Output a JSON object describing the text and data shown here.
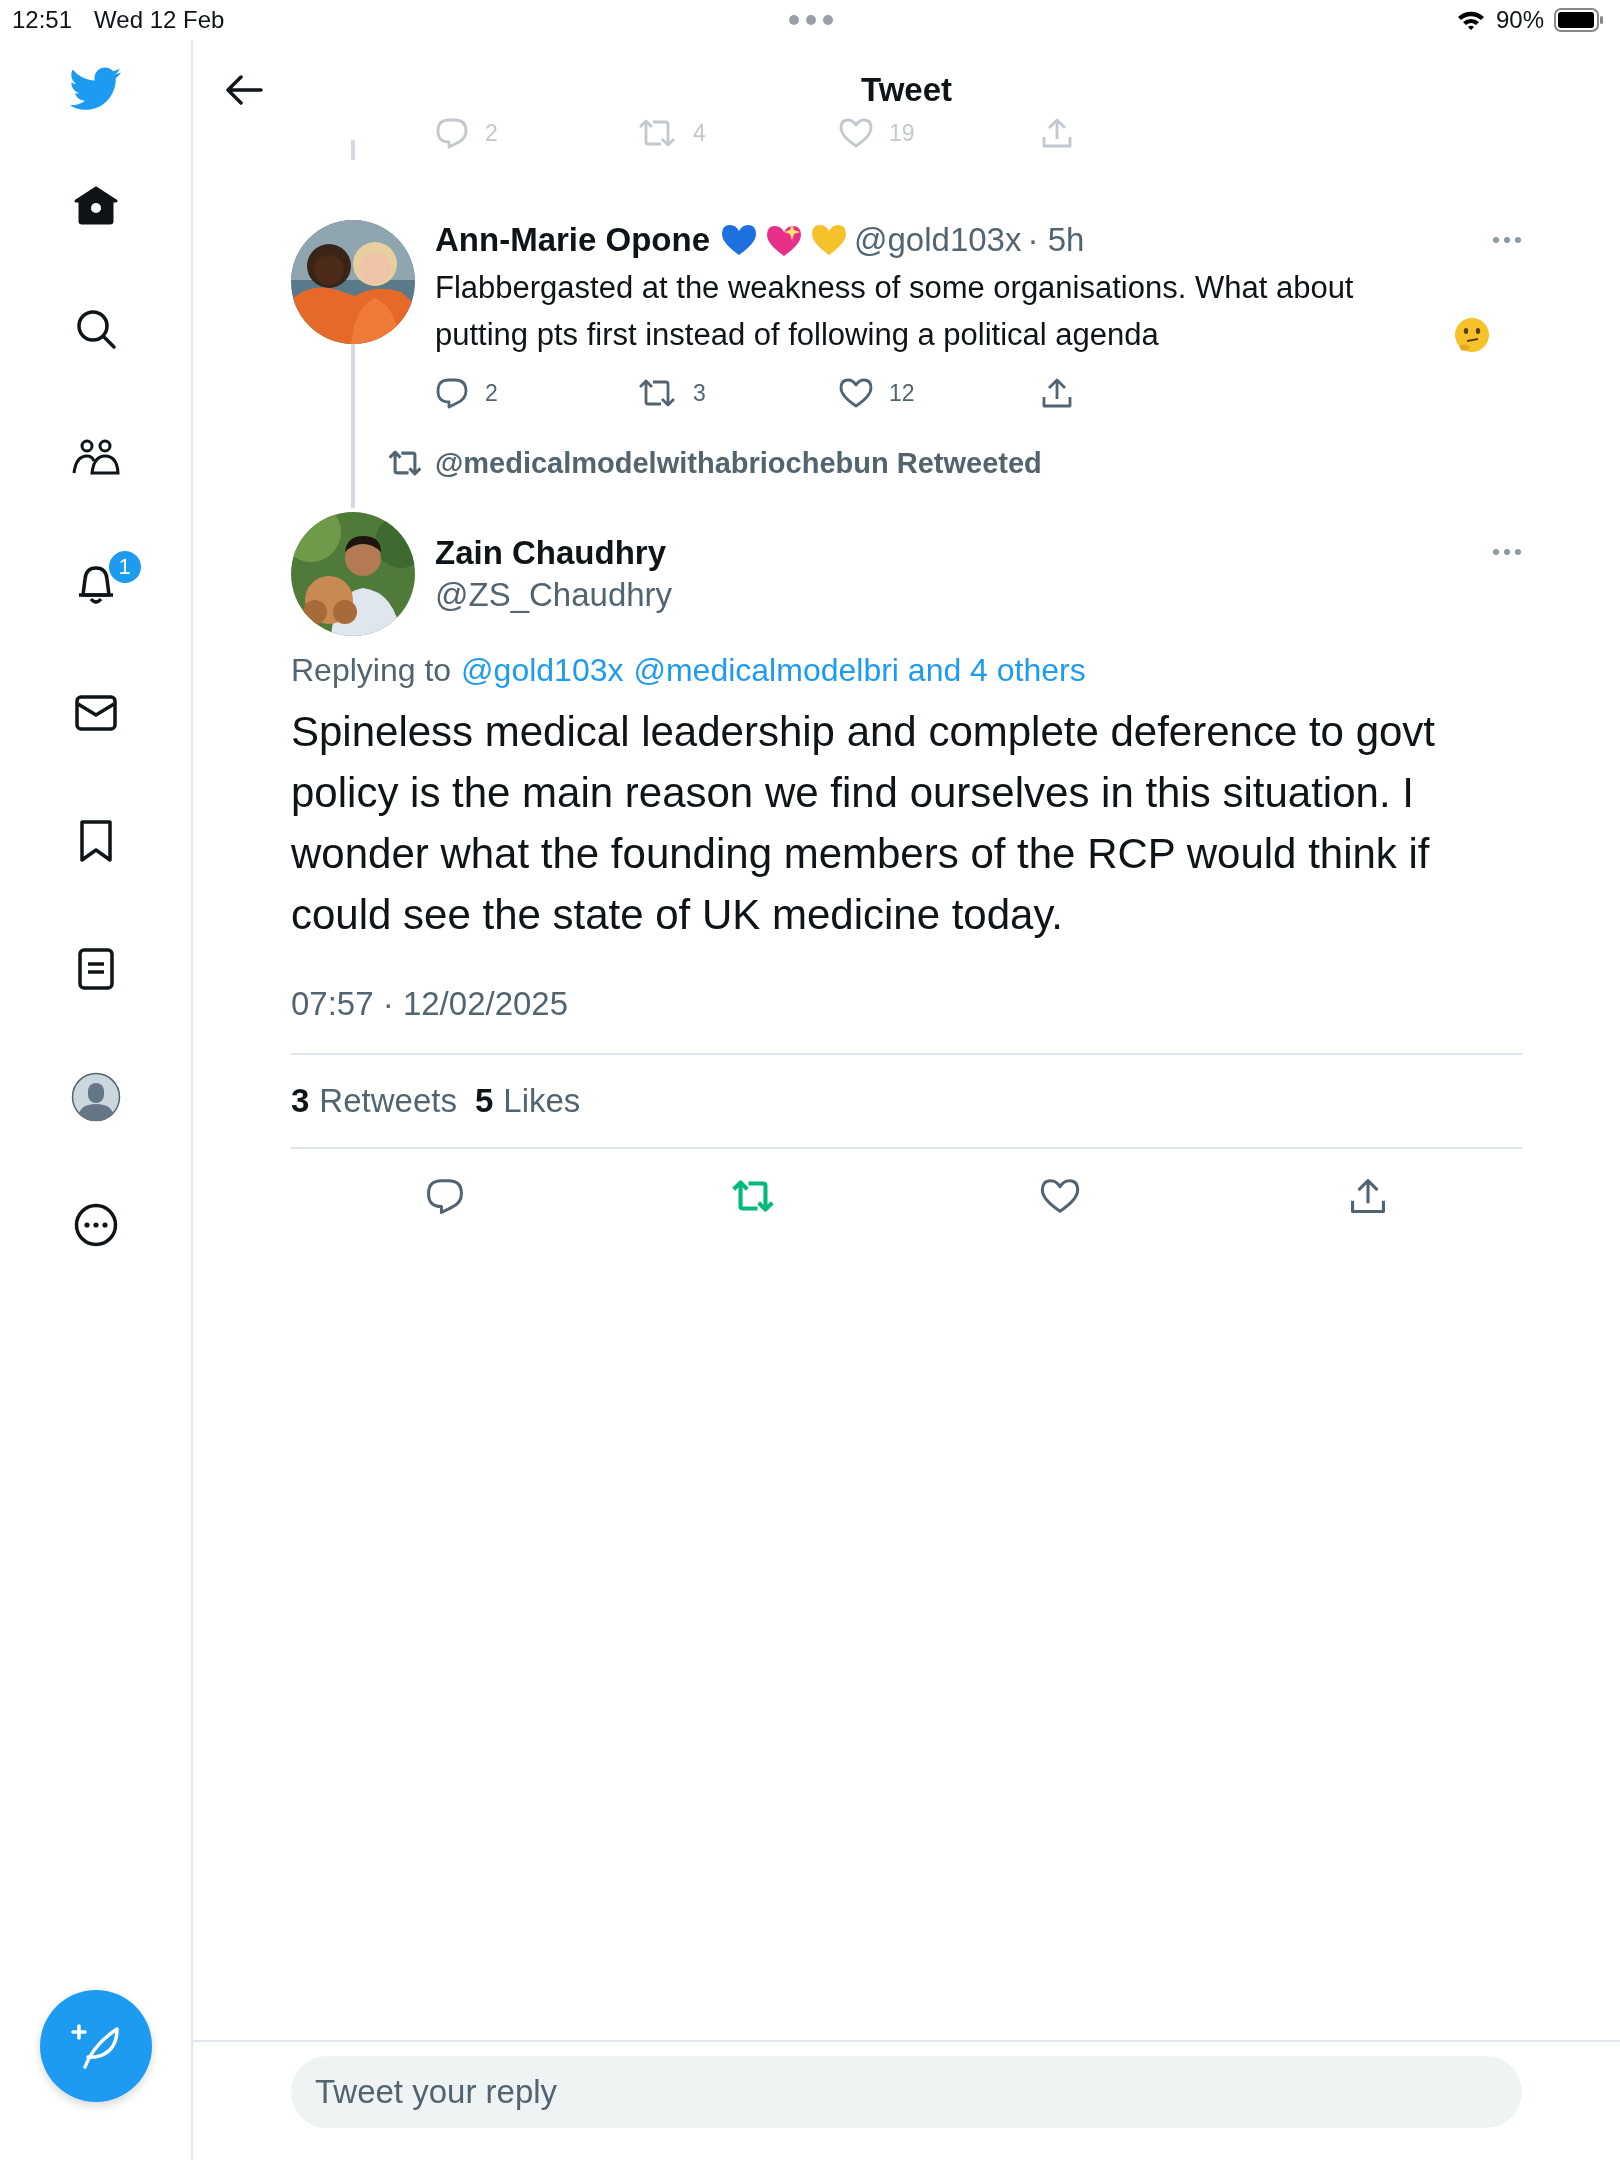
{
  "status_bar": {
    "time": "12:51",
    "date": "Wed 12 Feb",
    "battery": "90%"
  },
  "sidebar": {
    "items": [
      {
        "kind": "home",
        "selected": true
      },
      {
        "kind": "search",
        "selected": false
      },
      {
        "kind": "communities",
        "selected": false
      },
      {
        "kind": "notifications",
        "selected": false,
        "badge": "1"
      },
      {
        "kind": "messages",
        "selected": false
      },
      {
        "kind": "bookmarks",
        "selected": false
      },
      {
        "kind": "lists",
        "selected": false
      },
      {
        "kind": "profile",
        "selected": false
      },
      {
        "kind": "more",
        "selected": false
      }
    ]
  },
  "header": {
    "title": "Tweet"
  },
  "previous_tweet_actions": {
    "replies": "2",
    "retweets": "4",
    "likes": "19"
  },
  "reply_tweet": {
    "name": "Ann-Marie Opone",
    "handle": "@gold103x",
    "time": "· 5h",
    "text": "Flabbergasted at the weakness of some organisations. What about putting pts first instead of following a political agenda",
    "replies": "2",
    "retweets": "3",
    "likes": "12"
  },
  "retweet_notice": "@medicalmodelwithabriochebun Retweeted",
  "main_tweet": {
    "name": "Zain Chaudhry",
    "handle": "@ZS_Chaudhry",
    "replying_label": "Replying to",
    "replying_links": [
      "@gold103x",
      "@medicalmodelbri and 4 others"
    ],
    "text": "Spineless medical leadership and complete deference to govt policy is the main reason we find ourselves in this situation. I wonder what the founding members of the RCP would think if could see the state of UK medicine today.",
    "timestamp": "07:57 · 12/02/2025",
    "retweet_count": "3",
    "retweet_label": "Retweets",
    "like_count": "5",
    "like_label": "Likes",
    "retweeted": true,
    "liked": false
  },
  "reply_field": {
    "placeholder": "Tweet your reply"
  }
}
